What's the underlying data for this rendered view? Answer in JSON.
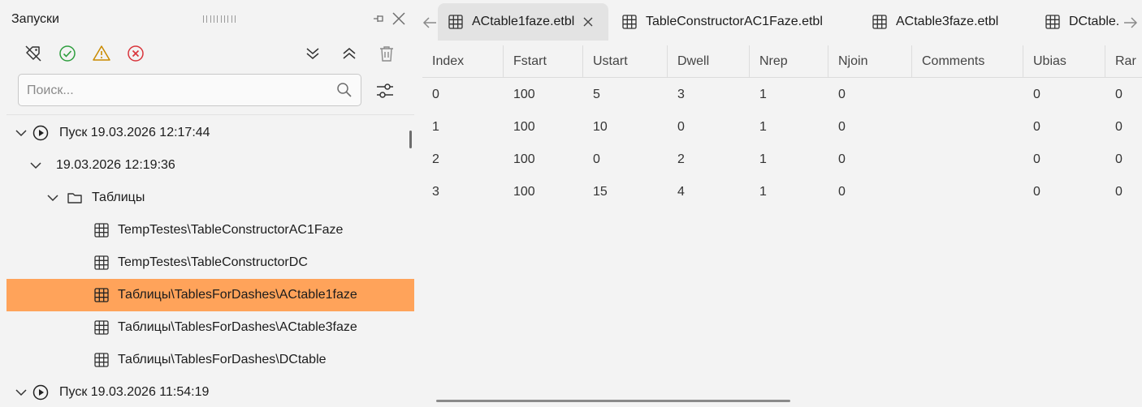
{
  "left_panel": {
    "title": "Запуски",
    "search": {
      "placeholder": "Поиск...",
      "value": ""
    }
  },
  "tree": [
    {
      "label": "Пуск 19.03.2026 12:17:44",
      "kind": "run",
      "expanded": true
    },
    {
      "label": "19.03.2026 12:19:36",
      "kind": "session",
      "expanded": true
    },
    {
      "label": "Таблицы",
      "kind": "folder",
      "expanded": true
    },
    {
      "label": "TempTestes\\TableConstructorAC1Faze",
      "kind": "table"
    },
    {
      "label": "TempTestes\\TableConstructorDC",
      "kind": "table"
    },
    {
      "label": "Таблицы\\TablesForDashes\\ACtable1faze",
      "kind": "table",
      "selected": true
    },
    {
      "label": "Таблицы\\TablesForDashes\\ACtable3faze",
      "kind": "table"
    },
    {
      "label": "Таблицы\\TablesForDashes\\DCtable",
      "kind": "table"
    },
    {
      "label": "Пуск 19.03.2026 11:54:19",
      "kind": "run",
      "expanded": true
    }
  ],
  "tabs": [
    {
      "label": "ACtable1faze.etbl",
      "active": true
    },
    {
      "label": "TableConstructorAC1Faze.etbl"
    },
    {
      "label": "ACtable3faze.etbl"
    },
    {
      "label": "DCtable."
    }
  ],
  "table": {
    "columns": [
      "Index",
      "Fstart",
      "Ustart",
      "Dwell",
      "Nrep",
      "Njoin",
      "Comments",
      "Ubias",
      "Rar"
    ],
    "rows": [
      [
        "0",
        "100",
        "5",
        "3",
        "1",
        "0",
        "",
        "0",
        "0"
      ],
      [
        "1",
        "100",
        "10",
        "0",
        "1",
        "0",
        "",
        "0",
        "0"
      ],
      [
        "2",
        "100",
        "0",
        "2",
        "1",
        "0",
        "",
        "0",
        "0"
      ],
      [
        "3",
        "100",
        "15",
        "4",
        "1",
        "0",
        "",
        "0",
        "0"
      ]
    ]
  },
  "colors": {
    "selection": "#ffa35a",
    "success": "#2e9e3e",
    "warning": "#c98a00",
    "error": "#d9343b"
  },
  "icons": [
    "clear-tags-icon",
    "success-filter-icon",
    "warning-filter-icon",
    "error-filter-icon",
    "collapse-all-icon",
    "expand-all-icon",
    "trash-icon",
    "search-icon",
    "filter-settings-icon",
    "pin-icon",
    "close-icon"
  ]
}
